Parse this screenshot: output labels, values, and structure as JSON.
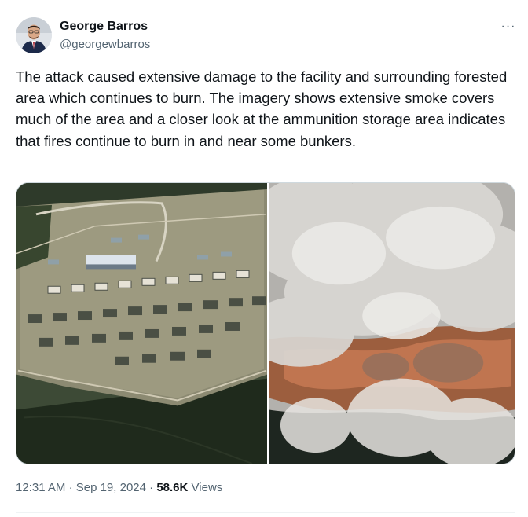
{
  "author": {
    "name": "George Barros",
    "handle": "@georgewbarros"
  },
  "more_menu": {
    "label": "···",
    "icon": "more-horizontal-icon"
  },
  "tweet_text": "The attack caused extensive damage to the facility and surrounding forested area which continues to burn. The imagery shows extensive smoke covers much of the area and a closer look at the ammunition storage area indicates that fires continue to burn in and near some bunkers.",
  "media": {
    "count": 2,
    "images": [
      {
        "subject": "satellite-image-before"
      },
      {
        "subject": "satellite-image-smoke"
      }
    ]
  },
  "meta": {
    "time": "12:31 AM",
    "separator": "·",
    "date": "Sep 19, 2024",
    "views_count": "58.6K",
    "views_label": "Views"
  },
  "colors": {
    "text_primary": "#0f1419",
    "text_secondary": "#536471",
    "border": "#cfd9de"
  }
}
